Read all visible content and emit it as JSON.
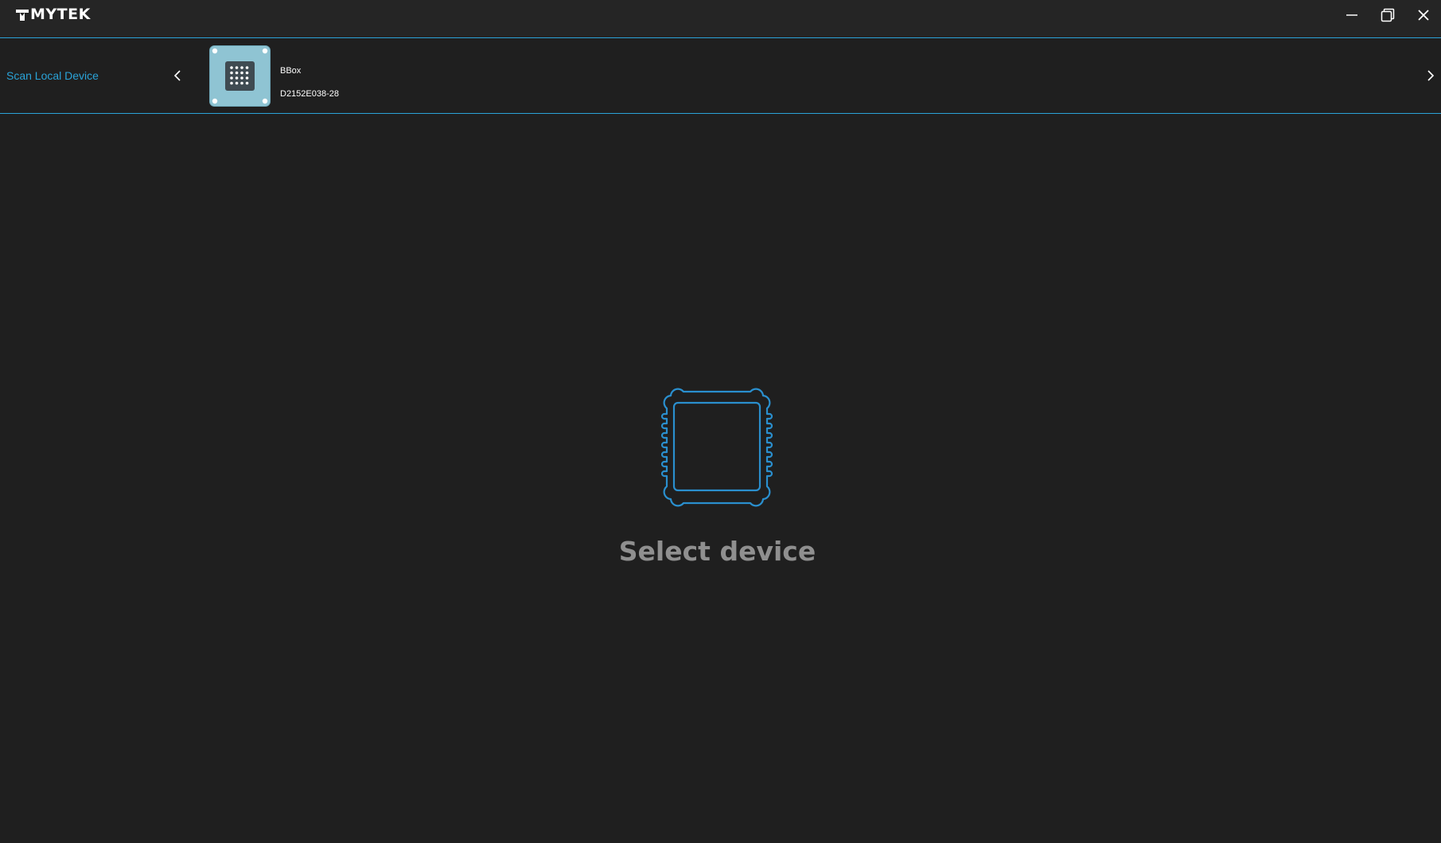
{
  "app": {
    "brand": "MYTEK"
  },
  "window_controls": {
    "minimize_icon": "minimize-icon",
    "restore_icon": "restore-icon",
    "close_icon": "close-icon"
  },
  "device_bar": {
    "scan_label": "Scan Local Device",
    "devices": [
      {
        "name": "BBox",
        "serial": "D2152E038-28",
        "icon": "device-thumbnail-icon"
      }
    ]
  },
  "empty_state": {
    "icon": "chip-icon",
    "message": "Select device"
  },
  "colors": {
    "accent": "#2aa3d8",
    "background": "#1f1f1f",
    "titlebar": "#252525",
    "muted_text": "#8f8f8f",
    "device_thumb": "#8fc4d3"
  }
}
